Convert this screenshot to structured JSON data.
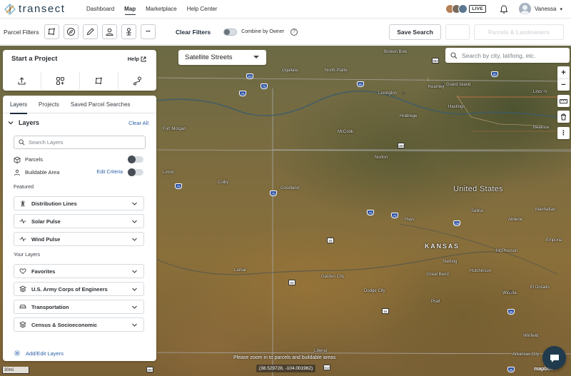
{
  "brand": {
    "name": "transect"
  },
  "nav": {
    "links": [
      "Dashboard",
      "Map",
      "Marketplace",
      "Help Center"
    ],
    "active": "Map",
    "live_label": "LIVE",
    "user_name": "Vanessa"
  },
  "filters": {
    "label": "Parcel Filters",
    "clear_label": "Clear Filters",
    "combine_label": "Combine by Owner",
    "help_glyph": "?",
    "save_search_label": "Save Search",
    "parcels_landowners_label": "Parcels & Landowners",
    "more_glyph": "•••"
  },
  "map": {
    "basemap": "Satellite Streets",
    "search_placeholder": "Search by city, lat/long, etc.",
    "zoom_in": "+",
    "zoom_out": "−",
    "zoom_notice": "Please zoom in to parcels and buildable areas",
    "coords": "(38.529728, -104.001962)",
    "scale": "30mi",
    "attribution": "mapbox",
    "labels": {
      "country": "United States",
      "state": "KANSAS",
      "cities": [
        "Ogallala",
        "North Platte",
        "Kearney",
        "Grand Island",
        "Lincoln",
        "Lexington",
        "Hastings",
        "Holdrege",
        "McCook",
        "Beatrice",
        "Fort Morgan",
        "Colby",
        "Goodland",
        "Norton",
        "Hays",
        "Salina",
        "Garden City",
        "Dodge City",
        "Wichita",
        "Hutchinson",
        "Great Bend",
        "Pratt",
        "Sterling",
        "Broken Bow",
        "Limon",
        "Lamar",
        "Liberal",
        "El Dorado",
        "Winfield",
        "Arkansas City",
        "Emporia",
        "Manhattan",
        "Abilene",
        "McPherson"
      ]
    }
  },
  "project": {
    "title": "Start a Project",
    "help_label": "Help"
  },
  "layers": {
    "tabs": [
      "Layers",
      "Projects",
      "Saved Parcel Searches"
    ],
    "title": "Layers",
    "clear_all": "Clear All",
    "search_placeholder": "Search Layers",
    "parcels_label": "Parcels",
    "buildable_label": "Buildable Area",
    "edit_criteria": "Edit Criteria",
    "featured_label": "Featured",
    "featured": [
      "Distribution Lines",
      "Solar Pulse",
      "Wind Pulse"
    ],
    "your_layers_label": "Your Layers",
    "your_layers": [
      "Favorites",
      "U.S. Army Corps of Engineers",
      "Transportation",
      "Census & Socioeconomic"
    ],
    "add_edit": "Add/Edit Layers"
  },
  "colors": {
    "brand": "#1f3b4d",
    "link": "#2b5fa8",
    "highway_shield": "#2a4fa0"
  }
}
